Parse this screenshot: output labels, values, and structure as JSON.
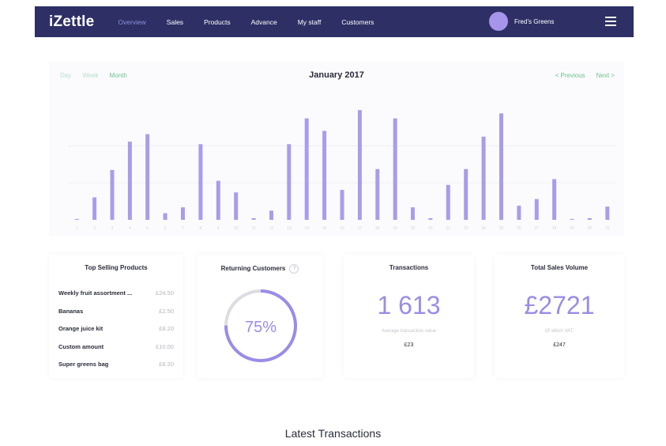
{
  "nav": {
    "logo": "iZettle",
    "links": [
      "Overview",
      "Sales",
      "Products",
      "Advance",
      "My staff",
      "Customers"
    ],
    "account_name": "Fred's Greens",
    "menu_icon": "hamburger-icon"
  },
  "chart_panel": {
    "tabs": [
      "Day",
      "Week",
      "Month"
    ],
    "title": "January 2017",
    "prev_label": "< Previous",
    "next_label": "Next >"
  },
  "chart_data": {
    "type": "bar",
    "title": "January 2017",
    "categories": [
      "1",
      "2",
      "3",
      "4",
      "5",
      "6",
      "7",
      "8",
      "9",
      "10",
      "11",
      "12",
      "13",
      "14",
      "15",
      "16",
      "17",
      "18",
      "19",
      "20",
      "21",
      "22",
      "23",
      "24",
      "25",
      "26",
      "27",
      "28",
      "29",
      "30",
      "31"
    ],
    "values": [
      1,
      27,
      60,
      94,
      103,
      8,
      15,
      91,
      47,
      33,
      2,
      11,
      91,
      122,
      107,
      36,
      132,
      61,
      122,
      15,
      2,
      42,
      61,
      100,
      128,
      17,
      25,
      49,
      1,
      2,
      16
    ],
    "colors": {
      "bar": "#a99cec",
      "background": "#fbfbfd"
    }
  },
  "cards": {
    "top_products": {
      "title": "Top Selling Products",
      "items": [
        {
          "name": "Weekly fruit assortment ...",
          "price": "£24.50"
        },
        {
          "name": "Bananas",
          "price": "£2.50"
        },
        {
          "name": "Orange juice kit",
          "price": "£8.20"
        },
        {
          "name": "Custom amount",
          "price": "£10.00"
        },
        {
          "name": "Super greens bag",
          "price": "£6.20"
        }
      ]
    },
    "returning": {
      "title": "Returning Customers",
      "help_icon": "?",
      "percent_label": "75%",
      "percent": 75
    },
    "transactions": {
      "title": "Transactions",
      "value": "1 613",
      "sub_label": "Average transaction value",
      "sub_value": "£23"
    },
    "sales_volume": {
      "title": "Total Sales Volume",
      "value": "£2721",
      "sub_label": "Of which VAT:",
      "sub_value": "£247"
    }
  },
  "footer": {
    "title": "Latest Transactions"
  },
  "colors": {
    "nav_bg": "#2d2f65",
    "accent_purple": "#9a8ce6",
    "accent_green": "#6ec28e"
  }
}
